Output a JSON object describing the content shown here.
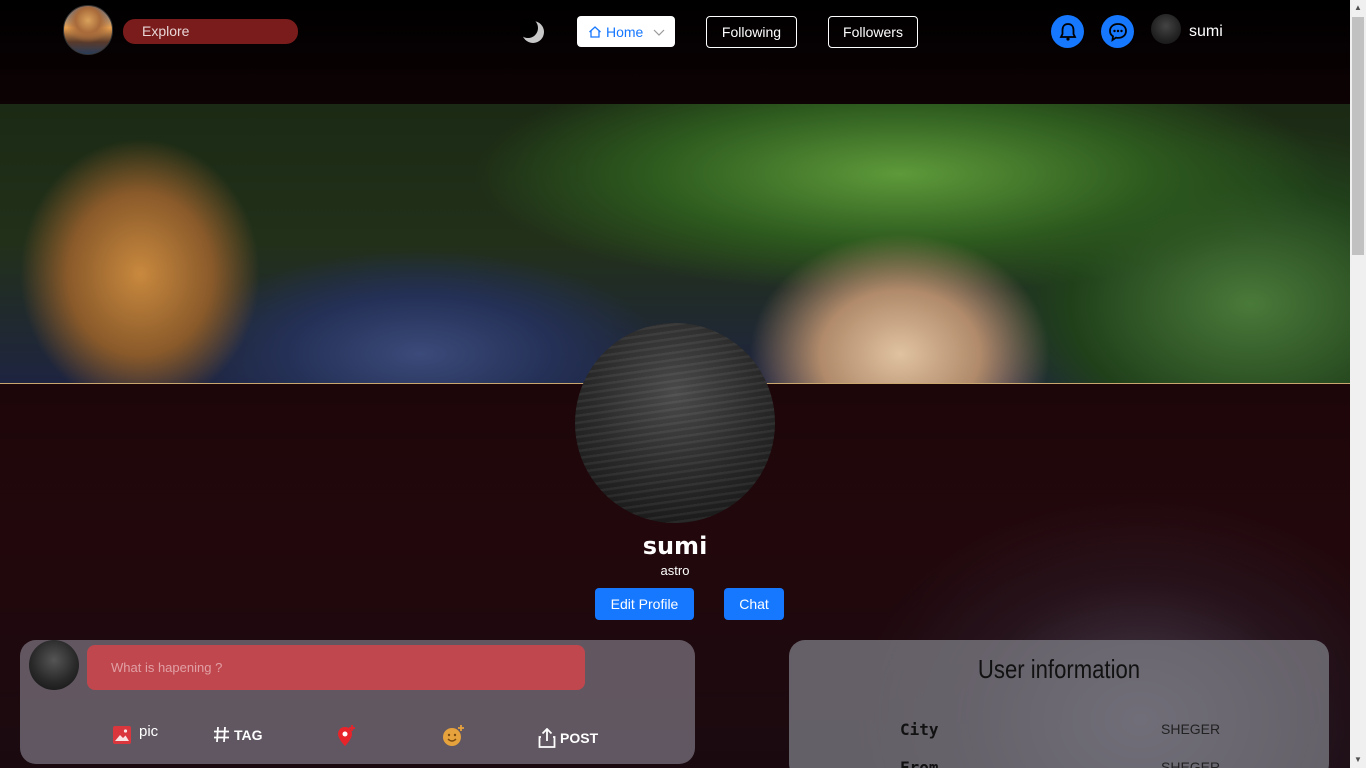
{
  "header": {
    "explore_label": "Explore",
    "nav": {
      "home_label": "Home",
      "following_label": "Following",
      "followers_label": "Followers"
    },
    "user_name": "sumi"
  },
  "profile": {
    "name": "sumi",
    "handle": "astro",
    "edit_label": "Edit Profile",
    "chat_label": "Chat"
  },
  "post": {
    "placeholder": "What is hapening ?",
    "actions": {
      "pic": "pic",
      "tag": "TAG",
      "post": "POST"
    }
  },
  "user_info": {
    "title": "User information",
    "rows": [
      {
        "label": "City",
        "value": "SHEGER"
      },
      {
        "label": "From",
        "value": "SHEGER"
      }
    ]
  },
  "colors": {
    "accent": "#1677ff",
    "explore_bg": "#7a1c1c",
    "input_bg": "#c0474e"
  },
  "icons": [
    "moon-icon",
    "home-icon",
    "chevron-down-icon",
    "bell-icon",
    "chat-bubble-icon",
    "image-icon",
    "hashtag-icon",
    "location-pin-icon",
    "emoji-icon",
    "share-icon"
  ]
}
